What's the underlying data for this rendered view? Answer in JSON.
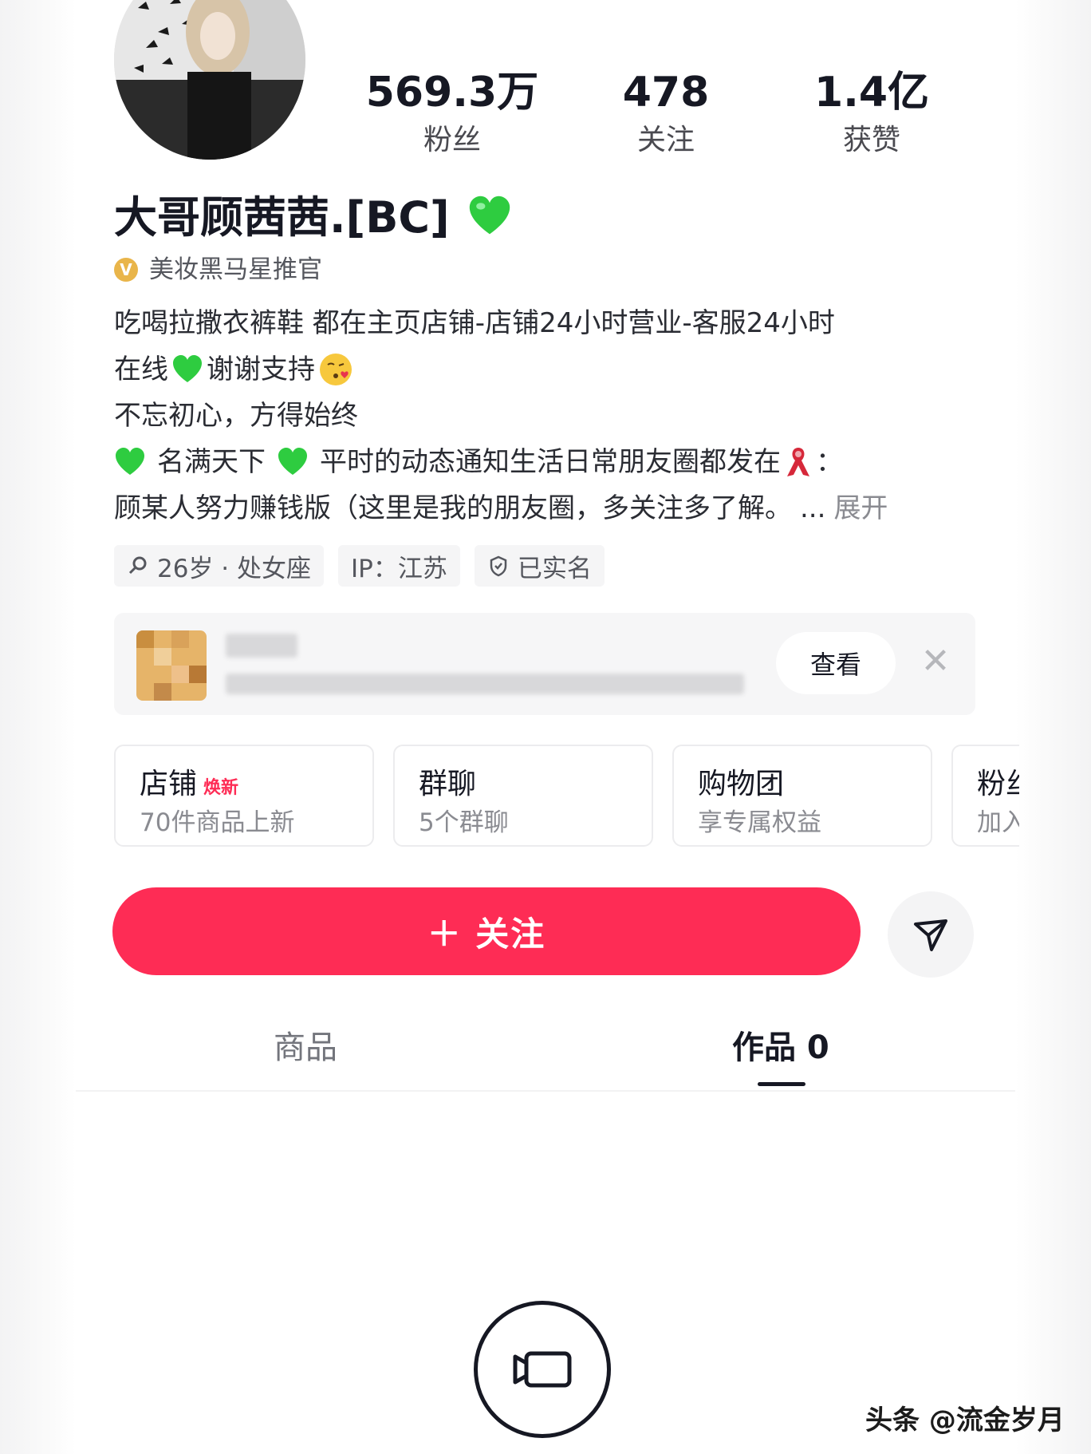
{
  "stats": [
    {
      "value": "569.3万",
      "label": "粉丝"
    },
    {
      "value": "478",
      "label": "关注"
    },
    {
      "value": "1.4亿",
      "label": "获赞"
    }
  ],
  "profile": {
    "name": "大哥顾茜茜.[BC]",
    "badge_icon": "verified-v-icon",
    "badge_text": "美妆黑马星推官"
  },
  "bio": {
    "line1": "吃喝拉撒衣裤鞋 都在主页店铺-店铺24小时营业-客服24小时",
    "line2_a": "在线",
    "line2_b": "谢谢支持",
    "line3": "不忘初心，方得始终",
    "line4_a": "名满天下",
    "line4_b": "平时的动态通知生活日常朋友圈都发在",
    "line4_c": "：",
    "line5": "顾某人努力赚钱版（这里是我的朋友圈，多关注多了解。",
    "line5_ellipsis": "...",
    "expand": "展开"
  },
  "tags": [
    {
      "icon": "search-icon",
      "text": "26岁 · 处女座"
    },
    {
      "icon": "",
      "text": "IP：江苏"
    },
    {
      "icon": "shield-icon",
      "text": "已实名"
    }
  ],
  "notice": {
    "view_label": "查看",
    "close_label": "✕"
  },
  "cards": [
    {
      "title": "店铺",
      "badge": "焕新",
      "sub": "70件商品上新"
    },
    {
      "title": "群聊",
      "badge": "",
      "sub": "5个群聊"
    },
    {
      "title": "购物团",
      "badge": "",
      "sub": "享专属权益"
    },
    {
      "title": "粉丝",
      "badge": "",
      "sub": "加入"
    }
  ],
  "actions": {
    "follow_label": "＋ 关注",
    "share_icon": "send-icon"
  },
  "tabs": [
    {
      "label": "商品",
      "active": false
    },
    {
      "label": "作品 0",
      "active": true
    }
  ],
  "camera": {
    "icon": "video-camera-icon"
  },
  "watermark": "头条 @流金岁月",
  "colors": {
    "accent": "#fe2c55",
    "heart": "#2ecc40",
    "badge": "#e9b54a"
  }
}
